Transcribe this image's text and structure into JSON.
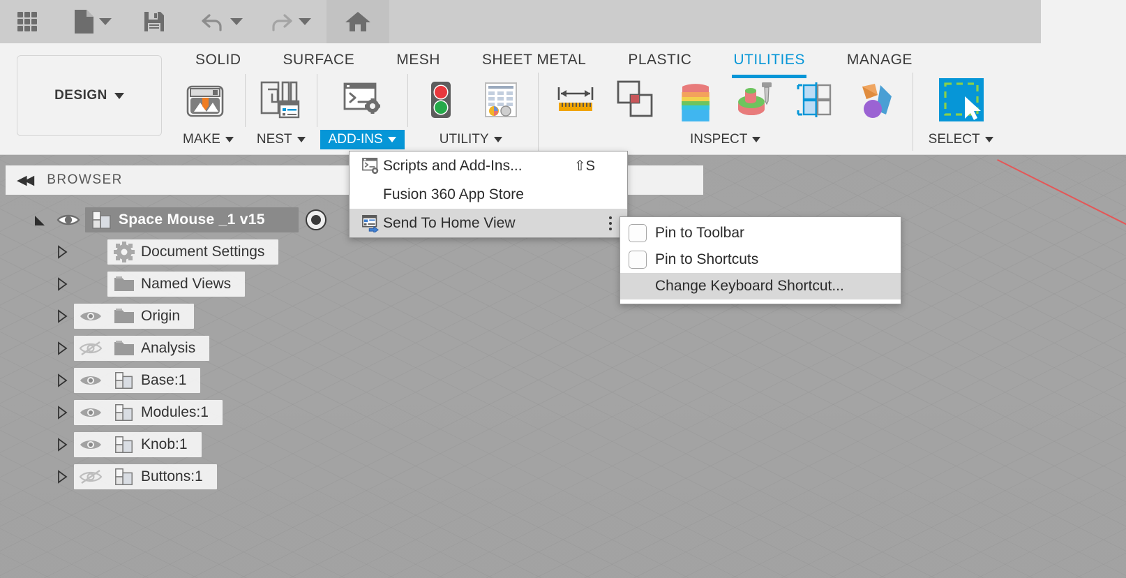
{
  "app": {
    "workspace_label": "DESIGN"
  },
  "quick_access": {
    "items": [
      {
        "name": "app-grid",
        "label": "Show Data Panel"
      },
      {
        "name": "file",
        "label": "File"
      },
      {
        "name": "save",
        "label": "Save"
      },
      {
        "name": "undo",
        "label": "Undo"
      },
      {
        "name": "redo",
        "label": "Redo"
      },
      {
        "name": "home",
        "label": "Home"
      }
    ]
  },
  "ribbon": {
    "tabs": [
      {
        "label": "SOLID",
        "active": false
      },
      {
        "label": "SURFACE",
        "active": false
      },
      {
        "label": "MESH",
        "active": false
      },
      {
        "label": "SHEET METAL",
        "active": false
      },
      {
        "label": "PLASTIC",
        "active": false
      },
      {
        "label": "UTILITIES",
        "active": true
      },
      {
        "label": "MANAGE",
        "active": false
      }
    ],
    "panels": [
      {
        "label": "MAKE",
        "active": false,
        "icons": [
          "3d-print-icon"
        ]
      },
      {
        "label": "NEST",
        "active": false,
        "icons": [
          "nest-icon"
        ]
      },
      {
        "label": "ADD-INS",
        "active": true,
        "icons": [
          "scripts-and-addins-icon"
        ]
      },
      {
        "label": "UTILITY",
        "active": false,
        "icons": [
          "traffic-light-icon",
          "spreadsheet-icon"
        ]
      },
      {
        "label": "INSPECT",
        "active": false,
        "icons": [
          "measure-icon",
          "interference-icon",
          "section-analysis-icon",
          "curvature-comb-icon",
          "component-color-cycle-icon",
          "display-icon"
        ]
      },
      {
        "label": "SELECT",
        "active": false,
        "icons": [
          "window-select-icon"
        ]
      }
    ]
  },
  "browser": {
    "title": "BROWSER",
    "collapse_label": "◀◀",
    "tree": [
      {
        "label": "Space Mouse _1 v15",
        "icon": "component-icon",
        "eye": "visible",
        "root": true,
        "has_radio": true,
        "indent": 0
      },
      {
        "label": "Document Settings",
        "icon": "gear-icon",
        "eye": "none",
        "root": false,
        "has_radio": false,
        "indent": 1
      },
      {
        "label": "Named Views",
        "icon": "folder-icon",
        "eye": "none",
        "root": false,
        "has_radio": false,
        "indent": 1
      },
      {
        "label": "Origin",
        "icon": "folder-icon",
        "eye": "visible",
        "root": false,
        "has_radio": false,
        "indent": 1
      },
      {
        "label": "Analysis",
        "icon": "folder-icon",
        "eye": "hidden",
        "root": false,
        "has_radio": false,
        "indent": 1
      },
      {
        "label": "Base:1",
        "icon": "component-icon",
        "eye": "visible",
        "root": false,
        "has_radio": false,
        "indent": 1
      },
      {
        "label": "Modules:1",
        "icon": "component-icon",
        "eye": "visible",
        "root": false,
        "has_radio": false,
        "indent": 1
      },
      {
        "label": "Knob:1",
        "icon": "component-icon",
        "eye": "visible",
        "root": false,
        "has_radio": false,
        "indent": 1
      },
      {
        "label": "Buttons:1",
        "icon": "component-icon",
        "eye": "hidden",
        "root": false,
        "has_radio": false,
        "indent": 1
      }
    ]
  },
  "addins_menu": {
    "items": [
      {
        "label": "Scripts and Add-Ins...",
        "shortcut": "⇧S",
        "icon": "scripts-and-addins-icon",
        "highlighted": false,
        "overflow": false
      },
      {
        "label": "Fusion 360 App Store",
        "shortcut": "",
        "icon": "none",
        "highlighted": false,
        "overflow": false
      },
      {
        "label": "Send To Home View",
        "shortcut": "",
        "icon": "send-to-home-view-icon",
        "highlighted": true,
        "overflow": true
      }
    ]
  },
  "context_submenu": {
    "items": [
      {
        "label": "Pin to Toolbar",
        "type": "checkbox",
        "checked": false,
        "highlighted": false
      },
      {
        "label": "Pin to Shortcuts",
        "type": "checkbox",
        "checked": false,
        "highlighted": false
      },
      {
        "label": "Change Keyboard Shortcut...",
        "type": "plain",
        "checked": false,
        "highlighted": true
      }
    ]
  },
  "colors": {
    "accent": "#0696d7",
    "toolbar_bg": "#cccccc",
    "ribbon_bg": "#f2f2f2",
    "selection_bg": "#8a8a8a",
    "menu_highlight": "#d8d8d8",
    "red_axis": "#f04a4a"
  }
}
